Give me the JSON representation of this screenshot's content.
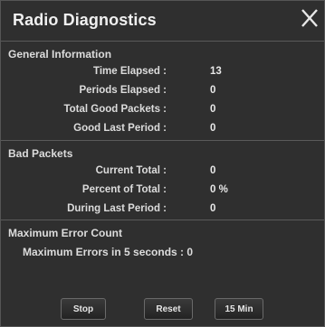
{
  "window": {
    "title": "Radio Diagnostics"
  },
  "general": {
    "title": "General Information",
    "rows": [
      {
        "label": "Time Elapsed :",
        "value": "13"
      },
      {
        "label": "Periods Elapsed :",
        "value": "0"
      },
      {
        "label": "Total Good Packets :",
        "value": "0"
      },
      {
        "label": "Good Last Period :",
        "value": "0"
      }
    ]
  },
  "bad": {
    "title": "Bad Packets",
    "rows": [
      {
        "label": "Current Total :",
        "value": "0"
      },
      {
        "label": "Percent of Total :",
        "value": "0 %"
      },
      {
        "label": "During Last Period :",
        "value": "0"
      }
    ]
  },
  "max": {
    "title": "Maximum Error Count",
    "line": "Maximum Errors in 5 seconds : 0"
  },
  "buttons": {
    "stop": "Stop",
    "reset": "Reset",
    "min15": "15 Min"
  }
}
